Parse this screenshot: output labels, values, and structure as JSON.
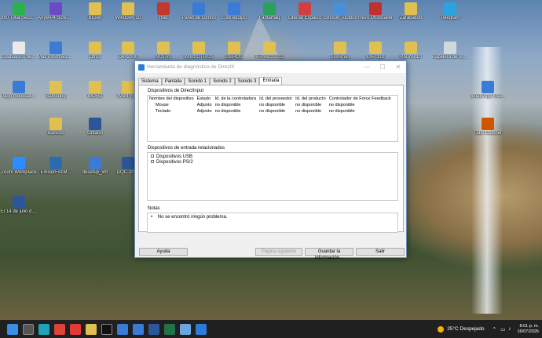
{
  "desktop": {
    "icons": [
      {
        "label": "360 Total Security",
        "color": "#2bb24c"
      },
      {
        "label": "AnyMP4 Screen Recorder",
        "color": "#6a4bc4"
      },
      {
        "label": "BiGen",
        "color": "#e0c050"
      },
      {
        "label": "Windows 10",
        "color": "#e0c050"
      },
      {
        "label": "Red",
        "color": "#c0392b"
      },
      {
        "label": "Panel de control",
        "color": "#3a7bd5"
      },
      {
        "label": "Este equipo",
        "color": "#3a7bd5"
      },
      {
        "label": "Fantamag",
        "color": "#2aa15a"
      },
      {
        "label": "Liberar Espacio",
        "color": "#d04040"
      },
      {
        "label": "iSkysoft Toolbox",
        "color": "#4a90d9"
      },
      {
        "label": "Revo Uninstaller",
        "color": "#c03030"
      },
      {
        "label": "Zarabaildo",
        "color": "#e0c050"
      },
      {
        "label": "Telegram",
        "color": "#2aa3e0"
      },
      {
        "label": "Graduación de Guerbiel Fau...",
        "color": "#eaeaea"
      },
      {
        "label": "Más información sobre esta ima...",
        "color": "#3a7bd5"
      },
      {
        "label": "Otros",
        "color": "#e0c050"
      },
      {
        "label": "De_2000",
        "color": "#e0c050"
      },
      {
        "label": "NOTAS",
        "color": "#e0c050"
      },
      {
        "label": "Word OTROS",
        "color": "#e0c050"
      },
      {
        "label": "LIBROS",
        "color": "#e0c050"
      },
      {
        "label": "FRANCISCO",
        "color": "#e0c050"
      },
      {
        "label": "Sistemas",
        "color": "#e0c050"
      },
      {
        "label": "LAP 110",
        "color": "#e0c050"
      },
      {
        "label": "Pal Win10",
        "color": "#e0c050"
      },
      {
        "label": "Papelera de reciclaje",
        "color": "#cfd8dc"
      },
      {
        "label": "Pago mensual otros",
        "color": "#3a7bd5"
      },
      {
        "label": "Samsung",
        "color": "#e0c050"
      },
      {
        "label": "WORD",
        "color": "#e0c050"
      },
      {
        "label": "Word y Ex",
        "color": "#e0c050"
      },
      {
        "label": "Bancos",
        "color": "#e0c050"
      },
      {
        "label": "Zoom Workplace",
        "color": "#2d8cff"
      },
      {
        "label": "EmisorFAcM...",
        "color": "#2b6cb0"
      },
      {
        "label": "desetup_xm",
        "color": "#3a7bd5"
      },
      {
        "label": "DQC-2025",
        "color": "#2b579a"
      },
      {
        "label": "El 14 de julio de 1967",
        "color": "#2b579a"
      },
      {
        "label": "Ontario",
        "color": "#2b579a"
      },
      {
        "label": "WhatsApp Image",
        "color": "#3a7bd5"
      },
      {
        "label": "Tube Catcher",
        "color": "#d35400"
      }
    ]
  },
  "window": {
    "title": "Herramienta de diagnóstico de DirectX",
    "controls": [
      "—",
      "☐",
      "✕"
    ],
    "tabs": [
      {
        "label": "Sistema",
        "active": false
      },
      {
        "label": "Pantalla",
        "active": false
      },
      {
        "label": "Sonido 1",
        "active": false
      },
      {
        "label": "Sonido 2",
        "active": false
      },
      {
        "label": "Sonido 3",
        "active": false
      },
      {
        "label": "Entrada",
        "active": true
      }
    ],
    "directinput": {
      "title": "Dispositivos de DirectInput",
      "headers": [
        "Nombre del dispositivo",
        "Estado",
        "Id. de la controladora",
        "Id. del proveedor",
        "Id. del producto",
        "Controlador de Force Feedback"
      ],
      "rows": [
        [
          "Mouse",
          "Adjunto",
          "no disponible",
          "no disponible",
          "no disponible",
          "no disponible"
        ],
        [
          "Teclado",
          "Adjunto",
          "no disponible",
          "no disponible",
          "no disponible",
          "no disponible"
        ]
      ]
    },
    "related": {
      "title": "Dispositivos de entrada relacionados",
      "items": [
        "Dispositivos USB",
        "Dispositivos PS/2"
      ]
    },
    "notes": {
      "title": "Notas",
      "items": [
        "No se encontró ningún problema."
      ]
    },
    "buttons": {
      "help": "Ayuda",
      "next_page": "Página siguiente",
      "save_all": "Guardar la información...",
      "exit": "Salir"
    }
  },
  "taskbar": {
    "apps": [
      {
        "name": "start",
        "color": "#3a8ee6"
      },
      {
        "name": "search",
        "color": "#555"
      },
      {
        "name": "edge",
        "color": "#1fa3b8"
      },
      {
        "name": "chrome",
        "color": "#db4437"
      },
      {
        "name": "youtube",
        "color": "#e53935"
      },
      {
        "name": "explorer",
        "color": "#e0c050"
      },
      {
        "name": "tiktok",
        "color": "#111"
      },
      {
        "name": "store",
        "color": "#3a7bd5"
      },
      {
        "name": "mail",
        "color": "#3a7bd5"
      },
      {
        "name": "word",
        "color": "#2b579a"
      },
      {
        "name": "excel",
        "color": "#217346"
      },
      {
        "name": "photos",
        "color": "#6aa7e0"
      },
      {
        "name": "dx",
        "color": "#2d7bd6"
      }
    ],
    "weather": "25°C  Despejado",
    "time": "8:01 p. m.",
    "date": "16/07/2026"
  }
}
